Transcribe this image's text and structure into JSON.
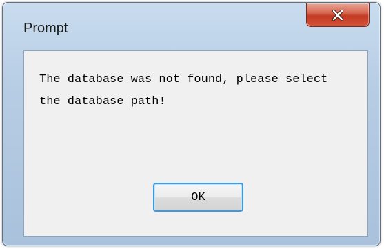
{
  "dialog": {
    "title": "Prompt",
    "message": "The database was not found, please select the database path!",
    "ok_label": "OK",
    "close_icon": "close-icon"
  },
  "colors": {
    "close_button": "#c7432a",
    "client_background": "#f0f0f0",
    "frame": "#b9cfe6",
    "ok_border": "#3c9ae0"
  }
}
